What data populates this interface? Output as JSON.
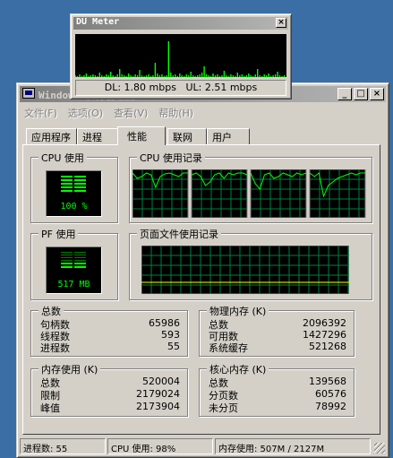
{
  "du_meter": {
    "title": "DU Meter",
    "close_label": "×",
    "dl_label": "DL:",
    "dl_value": "1.80 mbps",
    "ul_label": "UL:",
    "ul_value": "2.51 mbps"
  },
  "window": {
    "title": "Windows 任务管理器",
    "min_label": "_",
    "max_label": "□",
    "close_label": "×"
  },
  "menu": [
    "文件(F)",
    "选项(O)",
    "查看(V)",
    "帮助(H)"
  ],
  "tabs": [
    "应用程序",
    "进程",
    "性能",
    "联网",
    "用户"
  ],
  "active_tab": "性能",
  "performance": {
    "cpu_usage_label": "CPU 使用",
    "cpu_usage_value": "100 %",
    "cpu_history_label": "CPU 使用记录",
    "pf_usage_label": "PF 使用",
    "pf_usage_value": "517 MB",
    "pf_history_label": "页面文件使用记录"
  },
  "totals": {
    "label": "总数",
    "rows": [
      {
        "k": "句柄数",
        "v": "65986"
      },
      {
        "k": "线程数",
        "v": "593"
      },
      {
        "k": "进程数",
        "v": "55"
      }
    ]
  },
  "physical_memory": {
    "label": "物理内存 (K)",
    "rows": [
      {
        "k": "总数",
        "v": "2096392"
      },
      {
        "k": "可用数",
        "v": "1427296"
      },
      {
        "k": "系统缓存",
        "v": "521268"
      }
    ]
  },
  "commit_charge": {
    "label": "内存使用 (K)",
    "rows": [
      {
        "k": "总数",
        "v": "520004"
      },
      {
        "k": "限制",
        "v": "2179024"
      },
      {
        "k": "峰值",
        "v": "2173904"
      }
    ]
  },
  "kernel_memory": {
    "label": "核心内存 (K)",
    "rows": [
      {
        "k": "总数",
        "v": "139568"
      },
      {
        "k": "分页数",
        "v": "60576"
      },
      {
        "k": "未分页",
        "v": "78992"
      }
    ]
  },
  "status": {
    "processes": "进程数: 55",
    "cpu": "CPU 使用: 98%",
    "memory": "内存使用: 507M / 2127M"
  },
  "colors": {
    "desktop": "#3a6ea5",
    "face": "#d4d0c8",
    "graph_line": "#00ff00",
    "grid": "#008040"
  }
}
